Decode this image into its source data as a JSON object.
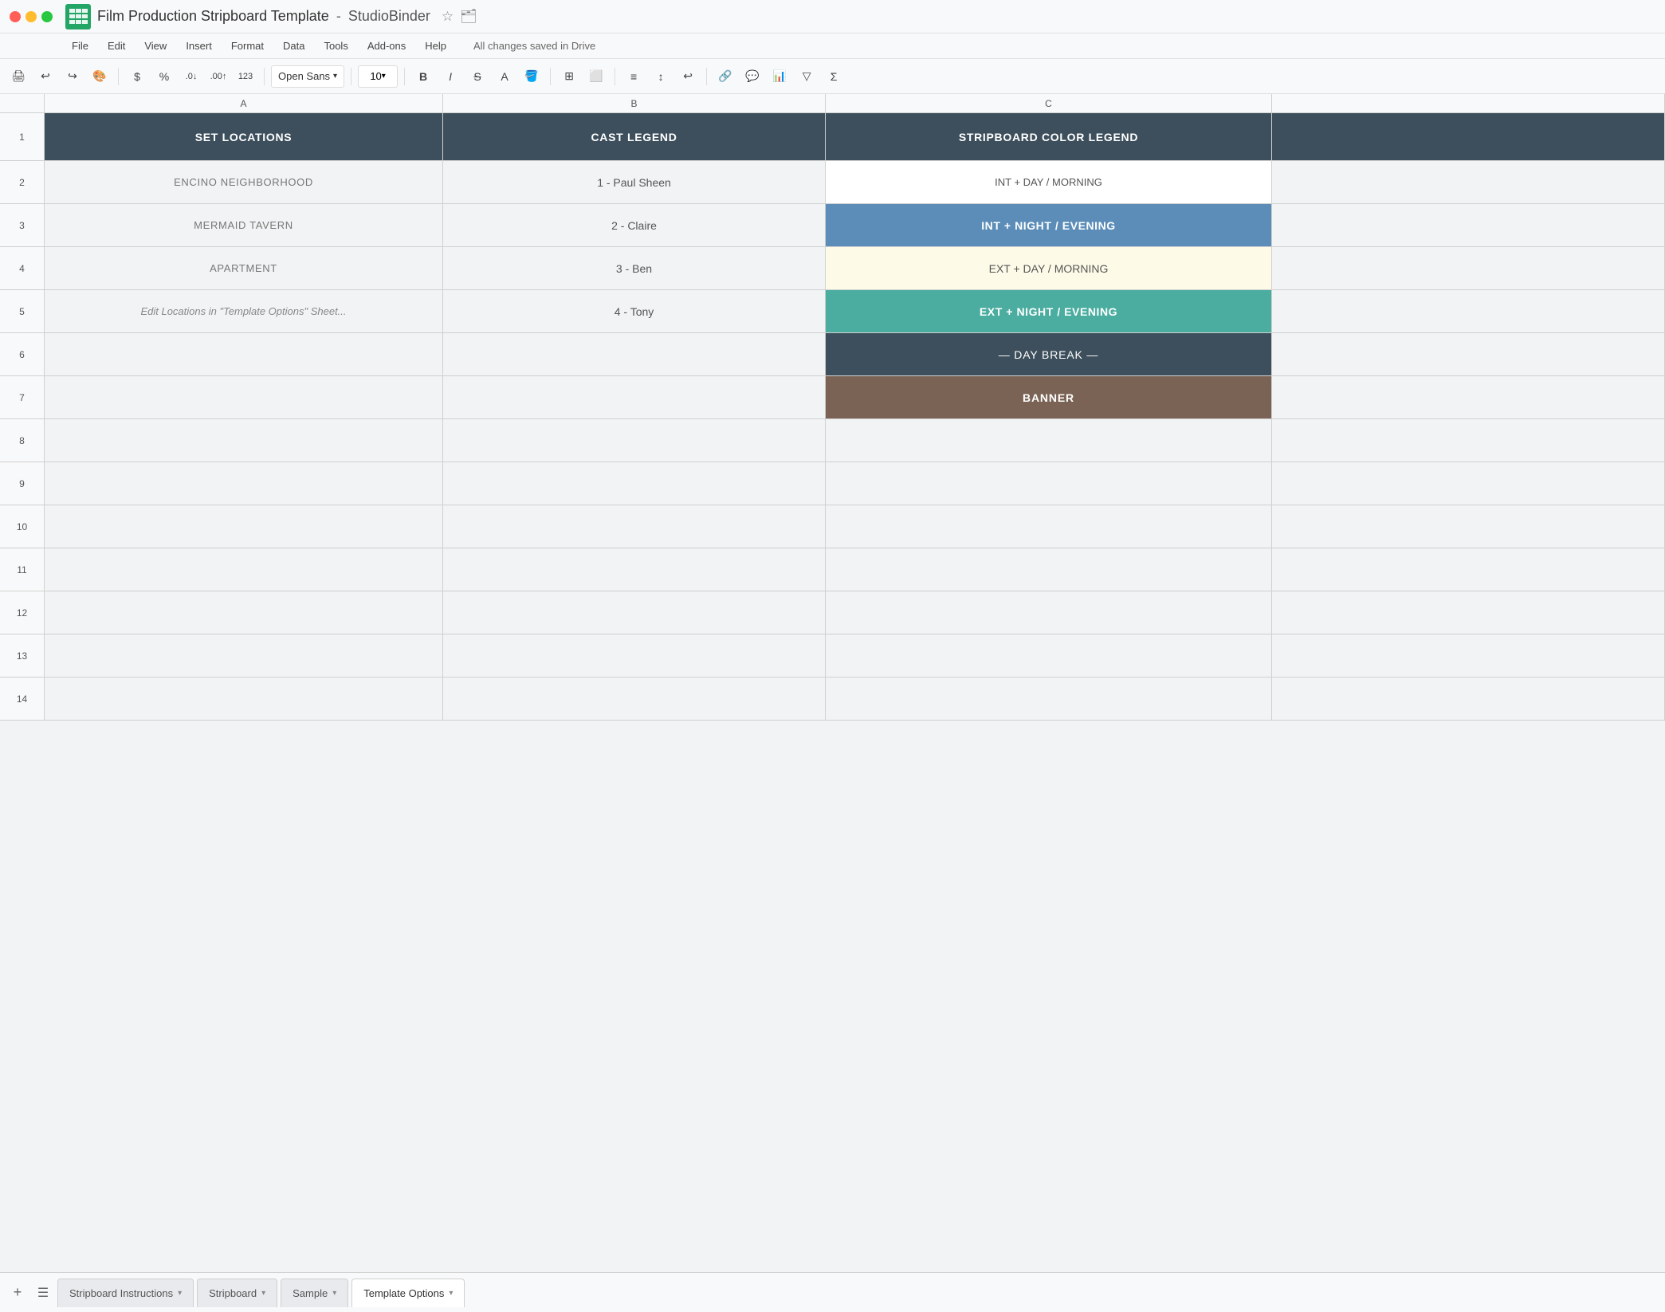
{
  "window": {
    "title": "Film Production Stripboard Template  -  StudioBinder",
    "title_main": "Film Production Stripboard Template",
    "title_brand": "StudioBinder",
    "save_status": "All changes saved in Drive"
  },
  "menu": {
    "items": [
      "File",
      "Edit",
      "View",
      "Insert",
      "Format",
      "Data",
      "Tools",
      "Add-ons",
      "Help"
    ]
  },
  "toolbar": {
    "font_name": "Open Sans",
    "font_size": "10",
    "currency_symbol": "$",
    "percent_symbol": "%"
  },
  "spreadsheet": {
    "col_headers": [
      "A",
      "B",
      "C"
    ],
    "header_row": {
      "col_a": "SET LOCATIONS",
      "col_b": "CAST LEGEND",
      "col_c": "STRIPBOARD COLOR LEGEND"
    },
    "rows": [
      {
        "num": 2,
        "col_a": "ENCINO NEIGHBORHOOD",
        "col_b": "1 - Paul Sheen",
        "col_c": "INT  +  DAY / MORNING",
        "col_c_style": "color-white"
      },
      {
        "num": 3,
        "col_a": "MERMAID TAVERN",
        "col_b": "2 - Claire",
        "col_c": "INT  +  NIGHT / EVENING",
        "col_c_style": "color-blue"
      },
      {
        "num": 4,
        "col_a": "APARTMENT",
        "col_b": "3 - Ben",
        "col_c": "EXT  +  DAY / MORNING",
        "col_c_style": "color-yellow"
      },
      {
        "num": 5,
        "col_a_italic": "Edit Locations in \"Template Options\" Sheet...",
        "col_b": "4 - Tony",
        "col_c": "EXT  +  NIGHT / EVENING",
        "col_c_style": "color-teal"
      },
      {
        "num": 6,
        "col_a": "",
        "col_b": "",
        "col_c": "— DAY BREAK —",
        "col_c_style": "color-dark"
      },
      {
        "num": 7,
        "col_a": "",
        "col_b": "",
        "col_c": "BANNER",
        "col_c_style": "color-brown"
      },
      {
        "num": 8,
        "col_a": "",
        "col_b": "",
        "col_c": ""
      },
      {
        "num": 9,
        "col_a": "",
        "col_b": "",
        "col_c": ""
      },
      {
        "num": 10,
        "col_a": "",
        "col_b": "",
        "col_c": ""
      },
      {
        "num": 11,
        "col_a": "",
        "col_b": "",
        "col_c": ""
      },
      {
        "num": 12,
        "col_a": "",
        "col_b": "",
        "col_c": ""
      },
      {
        "num": 13,
        "col_a": "",
        "col_b": "",
        "col_c": ""
      },
      {
        "num": 14,
        "col_a": "",
        "col_b": "",
        "col_c": ""
      }
    ],
    "tabs": [
      {
        "label": "Stripboard Instructions",
        "active": false
      },
      {
        "label": "Stripboard",
        "active": false
      },
      {
        "label": "Sample",
        "active": false
      },
      {
        "label": "Template Options",
        "active": true
      }
    ]
  }
}
